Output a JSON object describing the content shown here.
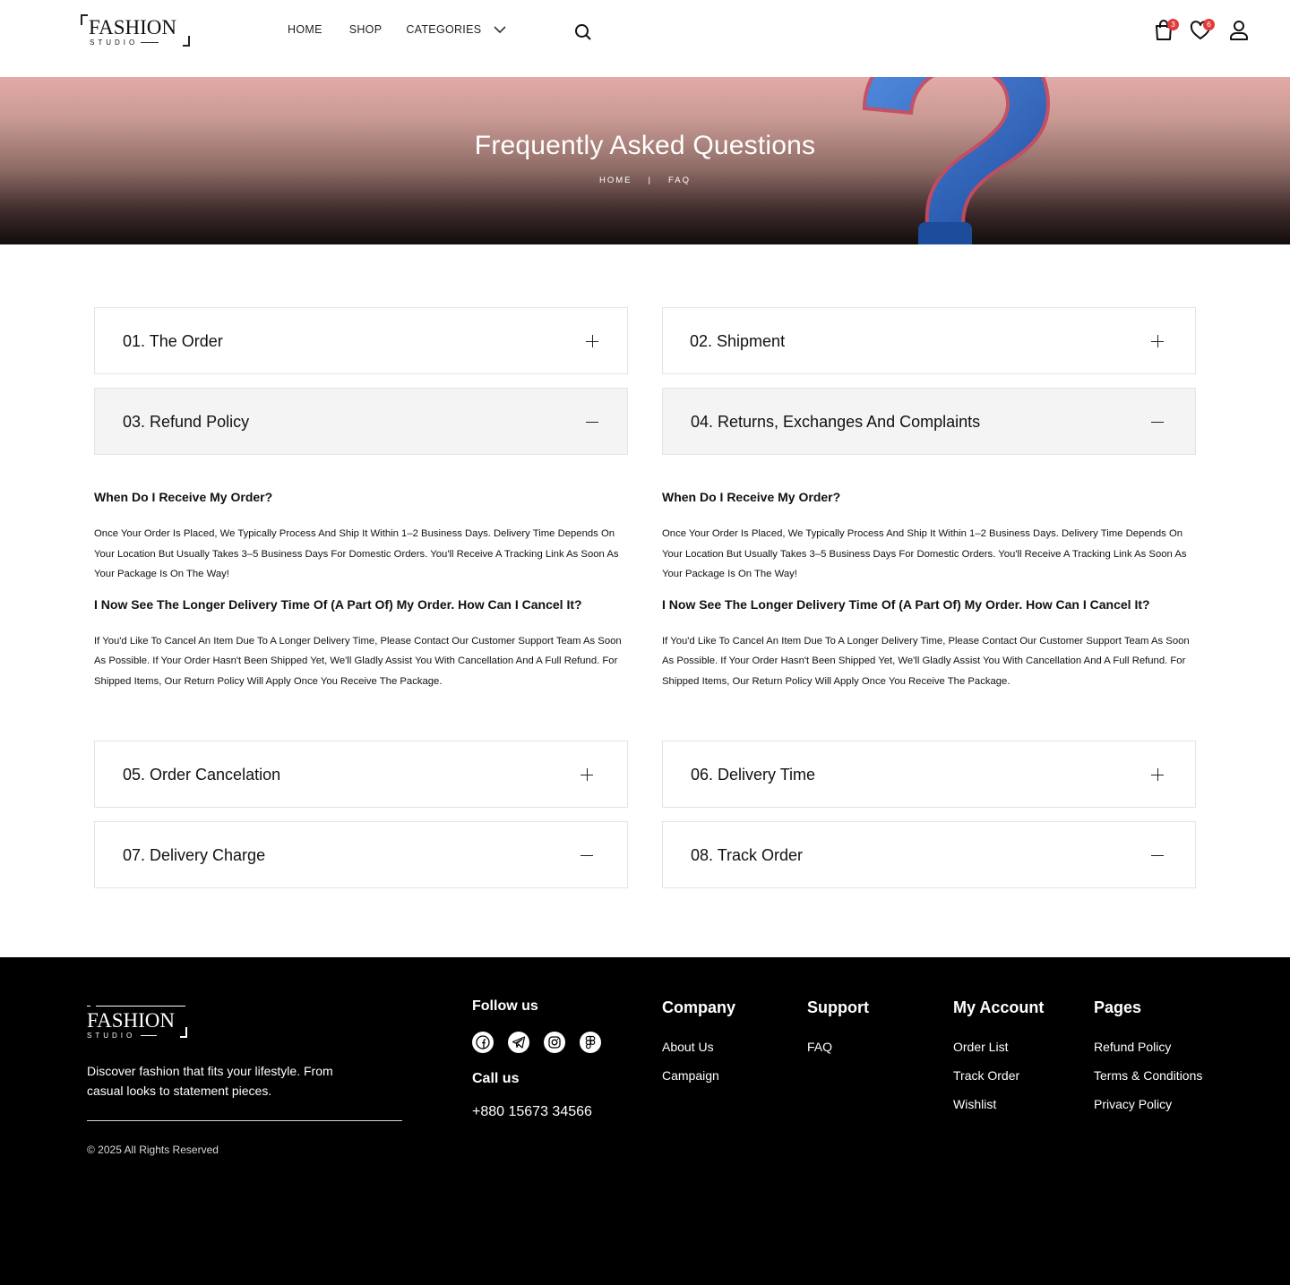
{
  "header": {
    "logo": {
      "main": "FASHION",
      "sub": "STUDIO"
    },
    "nav": {
      "home": "HOME",
      "shop": "SHOP",
      "categories": "CATEGORIES"
    },
    "cart_count": "3",
    "wishlist_count": "6"
  },
  "hero": {
    "title": "Frequently Asked Questions",
    "breadcrumb": {
      "home": "HOME",
      "sep": "|",
      "current": "FAQ"
    }
  },
  "faq": {
    "items": [
      {
        "title": "01. The Order",
        "state": "plus"
      },
      {
        "title": "02. Shipment",
        "state": "plus"
      },
      {
        "title": "03. Refund Policy",
        "state": "minus"
      },
      {
        "title": "04. Returns, Exchanges And Complaints",
        "state": "minus"
      },
      {
        "title": "05. Order Cancelation",
        "state": "plus"
      },
      {
        "title": "06. Delivery Time",
        "state": "plus"
      },
      {
        "title": "07. Delivery Charge",
        "state": "minus"
      },
      {
        "title": "08. Track Order",
        "state": "minus"
      }
    ],
    "left": {
      "q1": "When Do I Receive My Order?",
      "a1": "Once Your Order Is Placed, We Typically Process And Ship It Within 1–2 Business Days. Delivery Time Depends On Your Location But Usually Takes 3–5 Business Days For Domestic Orders. You'll Receive A Tracking Link As Soon As Your Package Is On The Way!",
      "q2": "I Now See The Longer Delivery Time Of (A Part Of) My Order. How Can I Cancel It?",
      "a2": "If You'd Like To Cancel An Item Due To A Longer Delivery Time, Please Contact Our Customer Support Team As Soon As Possible. If Your Order Hasn't Been Shipped Yet, We'll Gladly Assist You With Cancellation And A Full Refund. For Shipped Items, Our Return Policy Will Apply Once You Receive The Package."
    },
    "right": {
      "q1": "When Do I Receive My Order?",
      "a1": "Once Your Order Is Placed, We Typically Process And Ship It Within 1–2 Business Days. Delivery Time Depends On Your Location But Usually Takes 3–5 Business Days For Domestic Orders. You'll Receive A Tracking Link As Soon As Your Package Is On The Way!",
      "q2": "I Now See The Longer Delivery Time Of (A Part Of) My Order. How Can I Cancel It?",
      "a2": "If You'd Like To Cancel An Item Due To A Longer Delivery Time, Please Contact Our Customer Support Team As Soon As Possible. If Your Order Hasn't Been Shipped Yet, We'll Gladly Assist You With Cancellation And A Full Refund. For Shipped Items, Our Return Policy Will Apply Once You Receive The Package."
    }
  },
  "footer": {
    "logo": {
      "main": "FASHION",
      "sub": "STUDIO"
    },
    "description": "Discover fashion that fits your lifestyle. From casual looks to statement pieces.",
    "copyright": "© 2025 All Rights Reserved",
    "follow_label": "Follow us",
    "socials": [
      "facebook-icon",
      "telegram-icon",
      "instagram-icon",
      "figma-icon"
    ],
    "call_label": "Call us",
    "phone": "+880 15673 34566",
    "company": {
      "heading": "Company",
      "links": [
        "About Us",
        "Campaign"
      ]
    },
    "support": {
      "heading": "Support",
      "links": [
        "FAQ"
      ]
    },
    "account": {
      "heading": "My Account",
      "links": [
        "Order List",
        "Track Order",
        "Wishlist"
      ]
    },
    "pages": {
      "heading": "Pages",
      "links": [
        "Refund Policy",
        "Terms & Conditions",
        "Privacy Policy"
      ]
    }
  },
  "colors": {
    "badge": "#e23a3a",
    "footer_bg": "#000000",
    "open_panel_bg": "#f4f4f4",
    "question_mark": "#2f6fd0"
  }
}
